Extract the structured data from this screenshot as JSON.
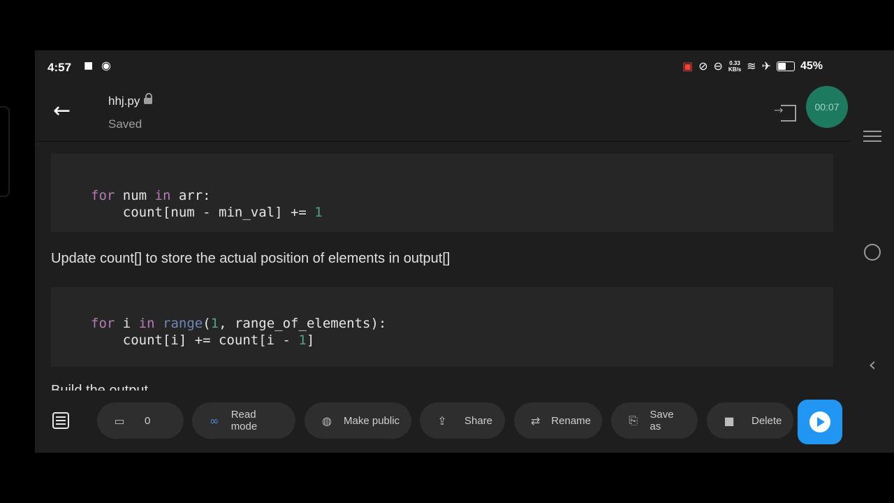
{
  "status_bar": {
    "time": "4:57",
    "net_speed_value": "0.33",
    "net_speed_unit": "KB/s",
    "battery_percent": "45%",
    "battery_level": 0.45
  },
  "header": {
    "file_name": "hhj.py",
    "save_status": "Saved",
    "timer": "00:07"
  },
  "content": {
    "code_block_1": {
      "lines": [
        [
          {
            "t": "for",
            "c": "kw"
          },
          {
            "t": " num ",
            "c": ""
          },
          {
            "t": "in",
            "c": "kw"
          },
          {
            "t": " arr:",
            "c": ""
          }
        ],
        [
          {
            "t": "    count[num - min_val] += ",
            "c": ""
          },
          {
            "t": "1",
            "c": "num"
          }
        ]
      ]
    },
    "paragraph_1": "Update count[] to store the actual position of elements in output[]",
    "code_block_2": {
      "lines": [
        [
          {
            "t": "for",
            "c": "kw"
          },
          {
            "t": " i ",
            "c": ""
          },
          {
            "t": "in",
            "c": "kw"
          },
          {
            "t": " ",
            "c": ""
          },
          {
            "t": "range",
            "c": "fn"
          },
          {
            "t": "(",
            "c": ""
          },
          {
            "t": "1",
            "c": "num"
          },
          {
            "t": ", range_of_elements):",
            "c": ""
          }
        ],
        [
          {
            "t": "    count[i] += count[i - ",
            "c": ""
          },
          {
            "t": "1",
            "c": "num"
          },
          {
            "t": "]",
            "c": ""
          }
        ]
      ]
    },
    "paragraph_2_partial": "Build the output"
  },
  "toolbar": {
    "comments_count": "0",
    "read_mode": "Read mode",
    "make_public": "Make public",
    "share": "Share",
    "rename": "Rename",
    "save_as": "Save as",
    "delete": "Delete"
  },
  "icons": [
    "video-icon",
    "chat-bubble-icon",
    "cast-icon",
    "mute-icon",
    "dnd-icon",
    "wifi-icon",
    "airplane-icon",
    "battery-icon",
    "back-arrow-icon",
    "lock-icon",
    "exit-icon",
    "list-icon",
    "comment-icon",
    "infinity-icon",
    "globe-icon",
    "upload-icon",
    "swap-icon",
    "save-as-icon",
    "trash-icon",
    "play-icon",
    "menu-icon",
    "home-icon",
    "nav-back-icon"
  ],
  "colors": {
    "accent_run": "#2196f3",
    "timer_bg": "#1e7a5f",
    "keyword": "#b77ab8",
    "number": "#4ea38a",
    "builtin": "#6f86b8"
  }
}
